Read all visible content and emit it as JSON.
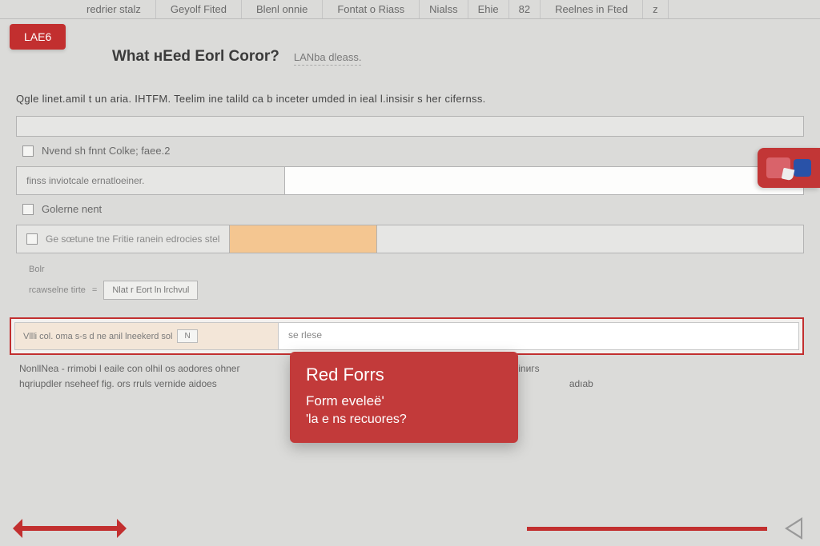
{
  "nav": {
    "items": [
      "redrier stalz",
      "Geyolf Fited",
      "Blenl onnie",
      "Fontat o Riass",
      "Nialss",
      "Ehie",
      "82",
      "Reelnes in Fted",
      "z"
    ]
  },
  "badge": {
    "label": "LAE6"
  },
  "title": {
    "main": "What нEed Eorl Coror?",
    "sub": "LANba dleass."
  },
  "intro": "Qgle linet.amil t un aria. IHTFM. Teelim ine talild ca b inceter umded in ieal l.insisir s her cifernss.",
  "checkbox1": {
    "label": "Nvend sh fnnt Colke; faee.2"
  },
  "twocol1": {
    "left": "finss inviotcale ernatloeiner."
  },
  "checkbox2": {
    "label": "Golerne nent"
  },
  "amber": {
    "label": "Ge sœtune tne Fritie ranein edrocies stel"
  },
  "group": {
    "top": "Bolr",
    "label": "rcawselne tirte",
    "select": "Nlat r Eort ln lrchvul"
  },
  "redframe": {
    "left": "Vllli col. oma s-s d ne anil lneekerd sol",
    "mini": "N",
    "right": "se rlese"
  },
  "card": {
    "title": "Red Forrs",
    "line1": "Form eveleë'",
    "line2": "'la e ns recuоres?"
  },
  "footnote": {
    "l1_left": "NonllNea - rrimobi l eaile con olhil os aodores ohneг",
    "l1_right": "ars el llded Fornn rinrr resinигs",
    "l2_left": "hqriupdler nseheef fig. ors rruls vernide aidoes",
    "l2_right": "adıab"
  }
}
